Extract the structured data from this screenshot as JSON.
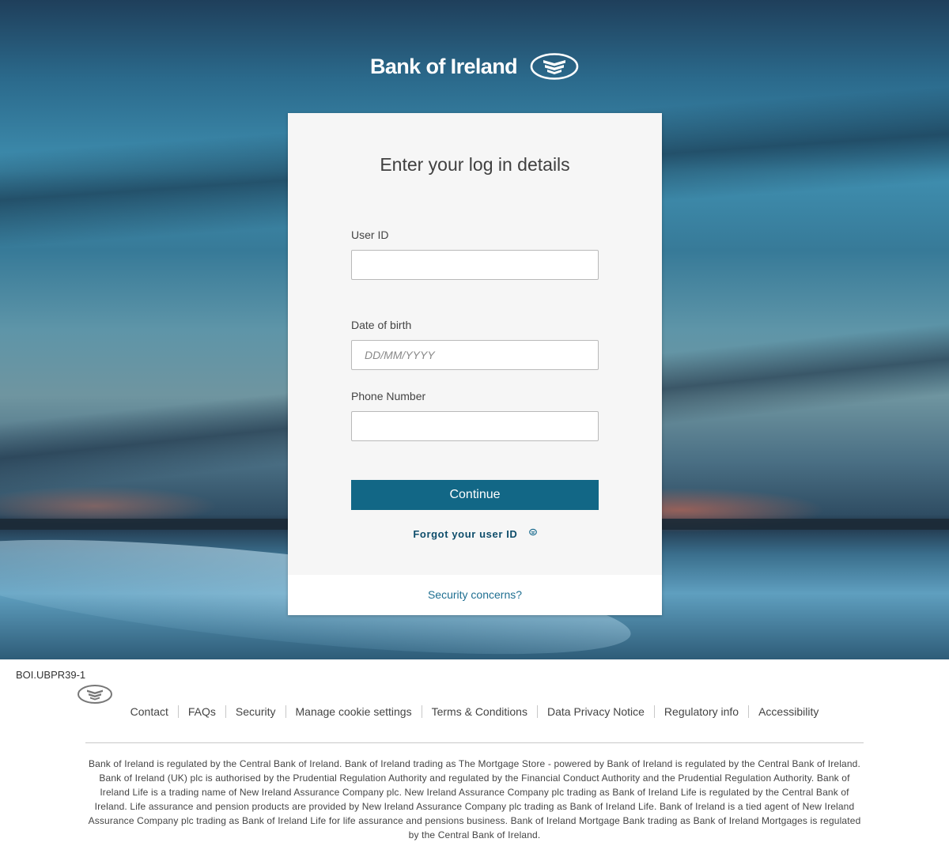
{
  "brand": {
    "name": "Bank of Ireland",
    "logo_icon": "boi-logo-icon",
    "primary_color": "#126786",
    "link_color": "#1f6f91"
  },
  "login": {
    "title": "Enter your log in details",
    "user_id": {
      "label": "User ID",
      "value": "",
      "placeholder": ""
    },
    "dob": {
      "label": "Date of birth",
      "value": "",
      "placeholder": "DD/MM/YYYY"
    },
    "phone": {
      "label": "Phone Number",
      "value": "",
      "placeholder": ""
    },
    "continue_label": "Continue",
    "forgot_label": "Forgot your user ID",
    "forgot_icon": "external-link-icon",
    "security_label": "Security concerns?"
  },
  "footer": {
    "version": "BOI.UBPR39-1",
    "links": [
      "Contact",
      "FAQs",
      "Security",
      "Manage cookie settings",
      "Terms & Conditions",
      "Data Privacy Notice",
      "Regulatory info",
      "Accessibility"
    ],
    "legal": "Bank of Ireland is regulated by the Central Bank of Ireland. Bank of Ireland trading as The Mortgage Store - powered by Bank of Ireland is regulated by the Central Bank of Ireland. Bank of Ireland (UK) plc is authorised by the Prudential Regulation Authority and regulated by the Financial Conduct Authority and the Prudential Regulation Authority. Bank of Ireland Life is a trading name of New Ireland Assurance Company plc. New Ireland Assurance Company plc trading as Bank of Ireland Life is regulated by the Central Bank of Ireland. Life assurance and pension products are provided by New Ireland Assurance Company plc trading as Bank of Ireland Life. Bank of Ireland is a tied agent of New Ireland Assurance Company plc trading as Bank of Ireland Life for life assurance and pensions business. Bank of Ireland Mortgage Bank trading as Bank of Ireland Mortgages is regulated by the Central Bank of Ireland."
  }
}
